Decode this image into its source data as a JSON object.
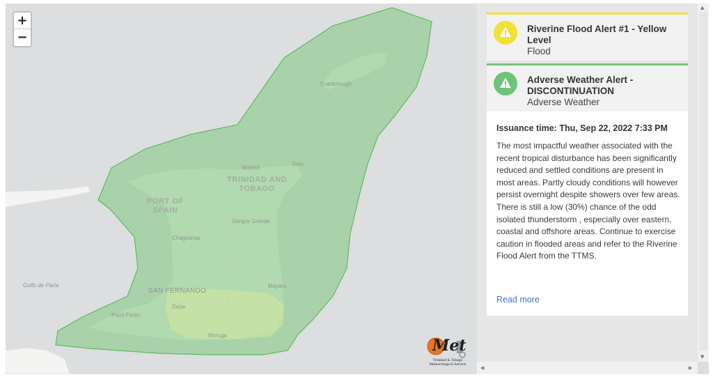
{
  "map": {
    "zoom_in": "+",
    "zoom_out": "−",
    "labels": {
      "scarborough": "Scarborough",
      "matelot": "Matelot",
      "toco": "Toco",
      "country_line1": "TRINIDAD AND",
      "country_line2": "TOBAGO",
      "port_line1": "PORT OF",
      "port_line2": "SPAIN",
      "sangre_grande": "Sangre Grande",
      "chaguanas": "Chaguanas",
      "golfo": "Golfo de Paria",
      "san_fernando": "SAN FERNANDO",
      "mayaro": "Mayaro",
      "debe": "Debe",
      "point_fortin": "Point Fortin",
      "moruga": "Moruga"
    },
    "colors": {
      "sea": "#dcdedf",
      "land": "#eef0ec",
      "alert_zone": "#7fc97f",
      "alert_border": "#5cbb5c",
      "flood_zone": "#d8ea9a"
    },
    "logo": {
      "mark": "Met",
      "line1": "Trinidad & Tobago",
      "line2": "Meteorological Service"
    }
  },
  "alerts": [
    {
      "title": "Riverine Flood Alert #1 - Yellow Level",
      "type": "Flood",
      "color": "#f4df3a",
      "icon": "warning-triangle-icon"
    },
    {
      "title": "Adverse Weather Alert - DISCONTINUATION",
      "type": "Adverse Weather",
      "color": "#72c57a",
      "icon": "warning-triangle-icon"
    }
  ],
  "detail": {
    "issuance": "Issuance time: Thu, Sep 22, 2022 7:33 PM",
    "body": "The most impactful weather associated with the recent tropical disturbance has been significantly reduced and settled conditions are present in most areas. Partly cloudy conditions will however persist overnight despite showers over few areas. There is still a low (30%) chance of the odd isolated thunderstorm , especially over eastern, coastal and offshore areas. Continue to exercise caution in flooded areas and refer to the Riverine Flood Alert from the TTMS.",
    "read_more": "Read more"
  }
}
